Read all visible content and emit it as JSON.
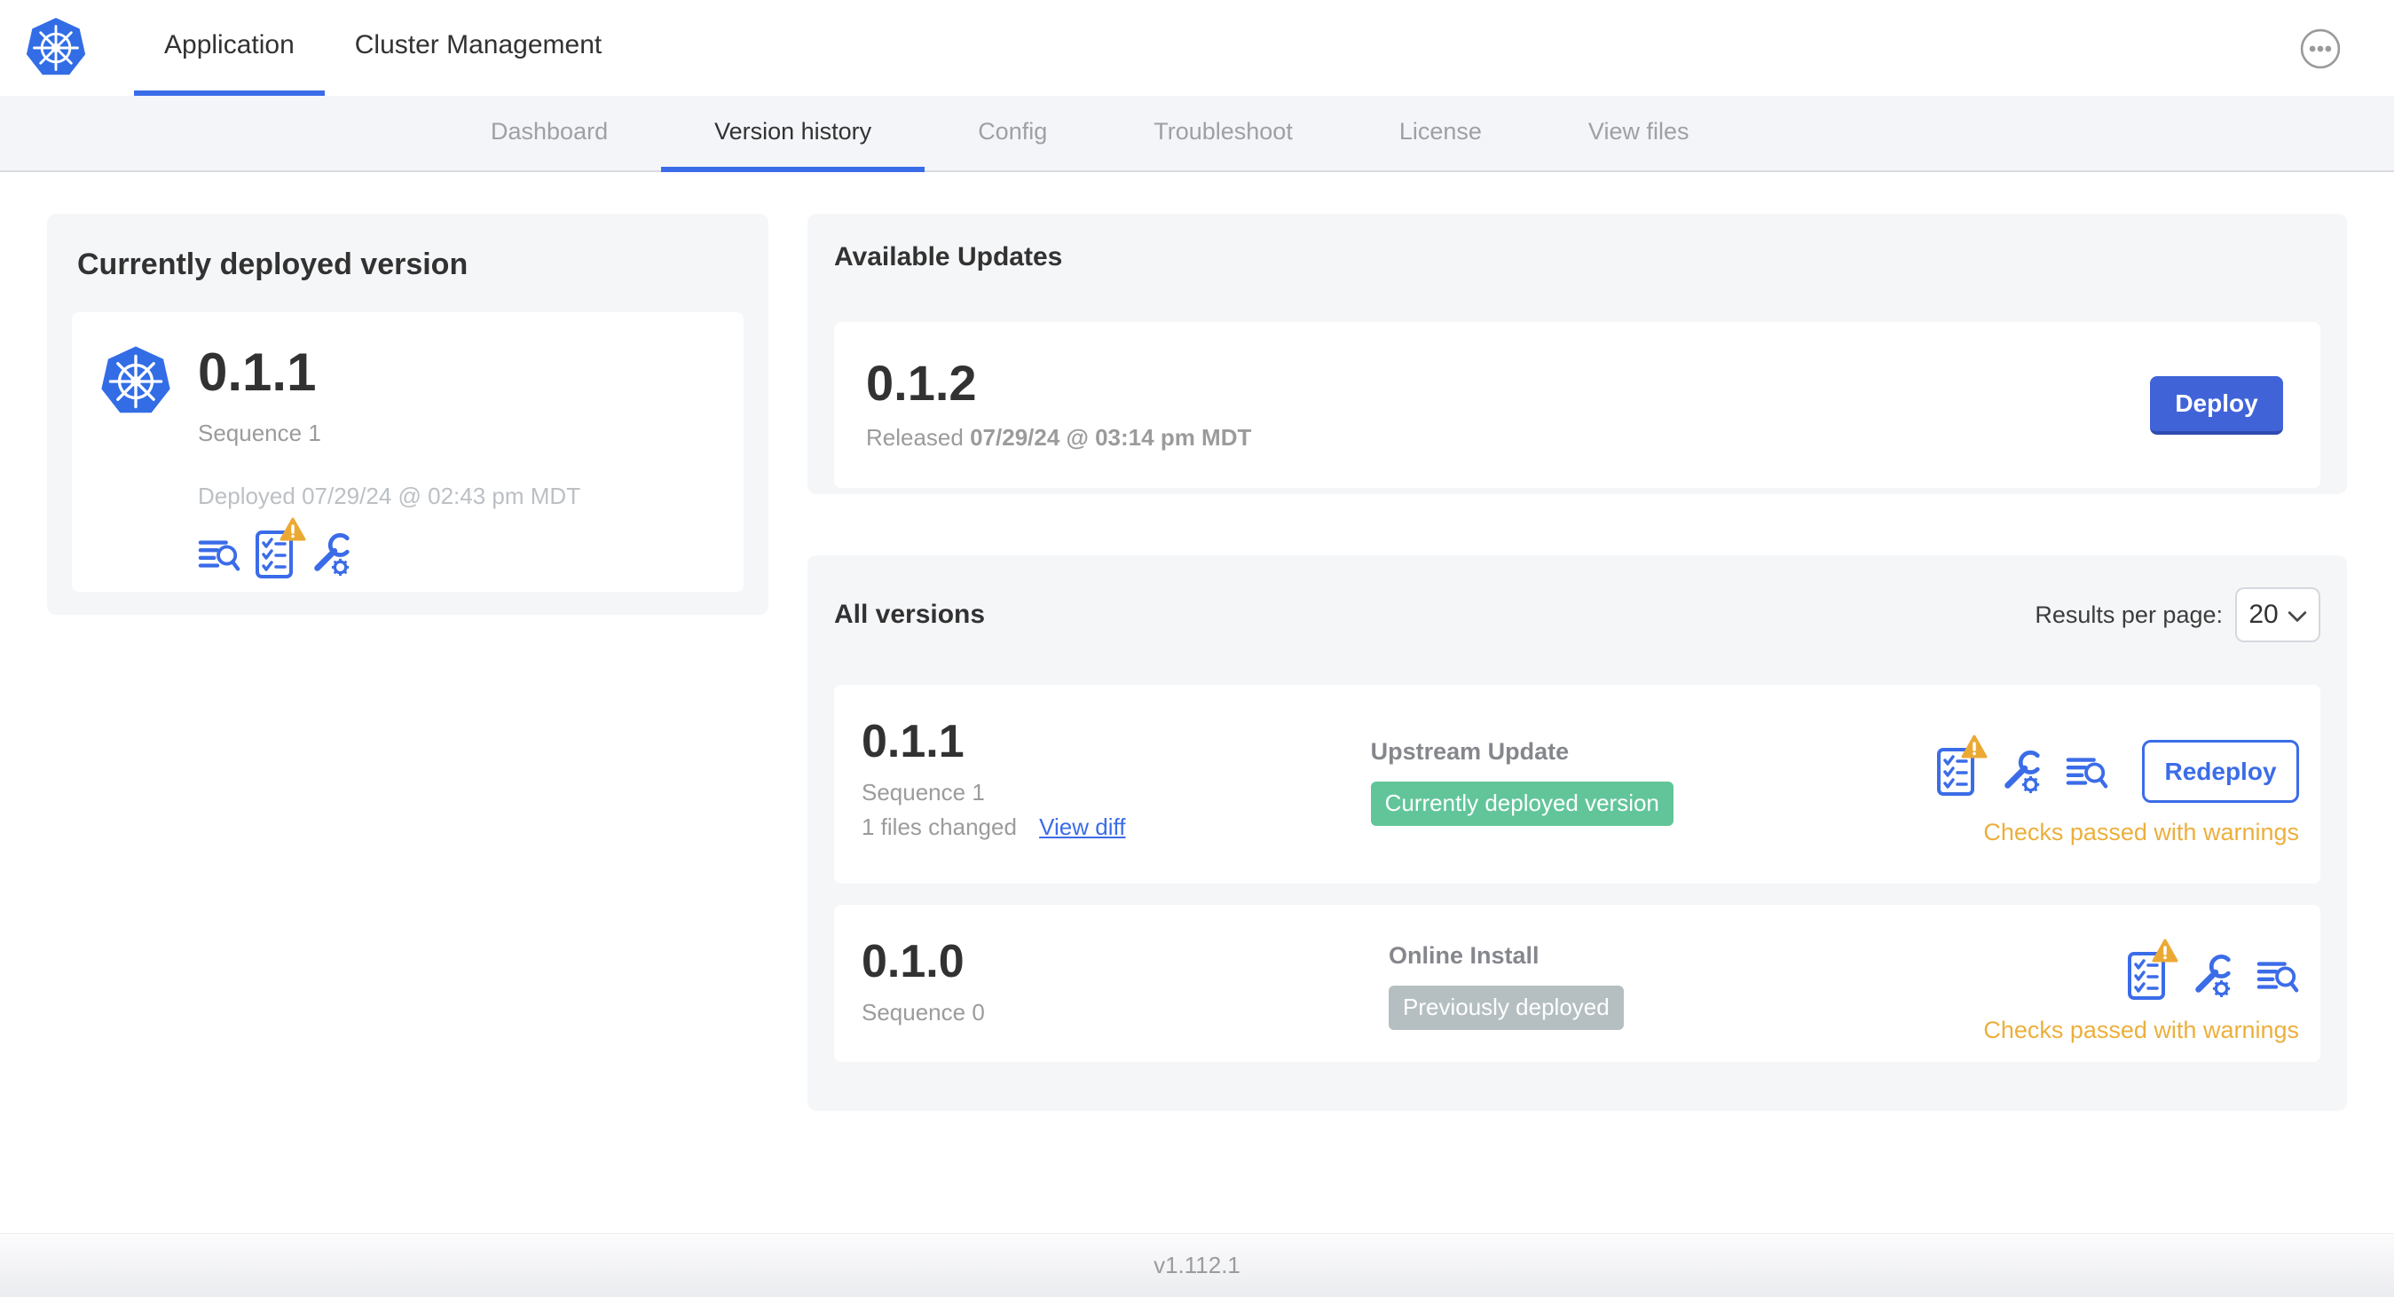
{
  "header": {
    "tabs": [
      {
        "label": "Application",
        "active": true
      },
      {
        "label": "Cluster Management",
        "active": false
      }
    ]
  },
  "subnav": {
    "items": [
      {
        "label": "Dashboard",
        "active": false
      },
      {
        "label": "Version history",
        "active": true
      },
      {
        "label": "Config",
        "active": false
      },
      {
        "label": "Troubleshoot",
        "active": false
      },
      {
        "label": "License",
        "active": false
      },
      {
        "label": "View files",
        "active": false
      }
    ]
  },
  "current_deployed": {
    "title": "Currently deployed version",
    "version": "0.1.1",
    "sequence": "Sequence 1",
    "deployed_at": "Deployed 07/29/24 @ 02:43 pm MDT",
    "icons": [
      "release-notes-icon",
      "preflight-checks-warning-icon",
      "config-icon"
    ]
  },
  "available_updates": {
    "title": "Available Updates",
    "version": "0.1.2",
    "released_label": "Released",
    "released_value": "07/29/24 @ 03:14 pm MDT",
    "deploy_button": "Deploy"
  },
  "all_versions": {
    "title": "All versions",
    "results_per_page_label": "Results per page:",
    "results_per_page_value": "20",
    "rows": [
      {
        "version": "0.1.1",
        "sequence": "Sequence 1",
        "files_changed": "1 files changed",
        "view_diff": "View diff",
        "source": "Upstream Update",
        "badge": "Currently deployed version",
        "badge_type": "green",
        "status": "Checks passed with warnings",
        "action": "Redeploy",
        "icons": [
          "preflight-checks-warning-icon",
          "config-icon",
          "release-notes-icon"
        ]
      },
      {
        "version": "0.1.0",
        "sequence": "Sequence 0",
        "source": "Online Install",
        "badge": "Previously deployed",
        "badge_type": "gray",
        "status": "Checks passed with warnings",
        "icons": [
          "preflight-checks-warning-icon",
          "config-icon",
          "release-notes-icon"
        ]
      }
    ]
  },
  "footer": {
    "app_version": "v1.112.1"
  },
  "colors": {
    "accent_blue": "#3b6ce8",
    "k8s_logo_blue": "#326de6",
    "deploy_button_blue": "#4064d8",
    "badge_green": "#62c59a",
    "badge_gray": "#b5bfc1",
    "warning_amber": "#ecaf3c",
    "active_text": "#323232",
    "muted_text": "#9b9b9b",
    "subnav_bg": "#f4f5f8",
    "card_bg": "#f5f6f8"
  }
}
